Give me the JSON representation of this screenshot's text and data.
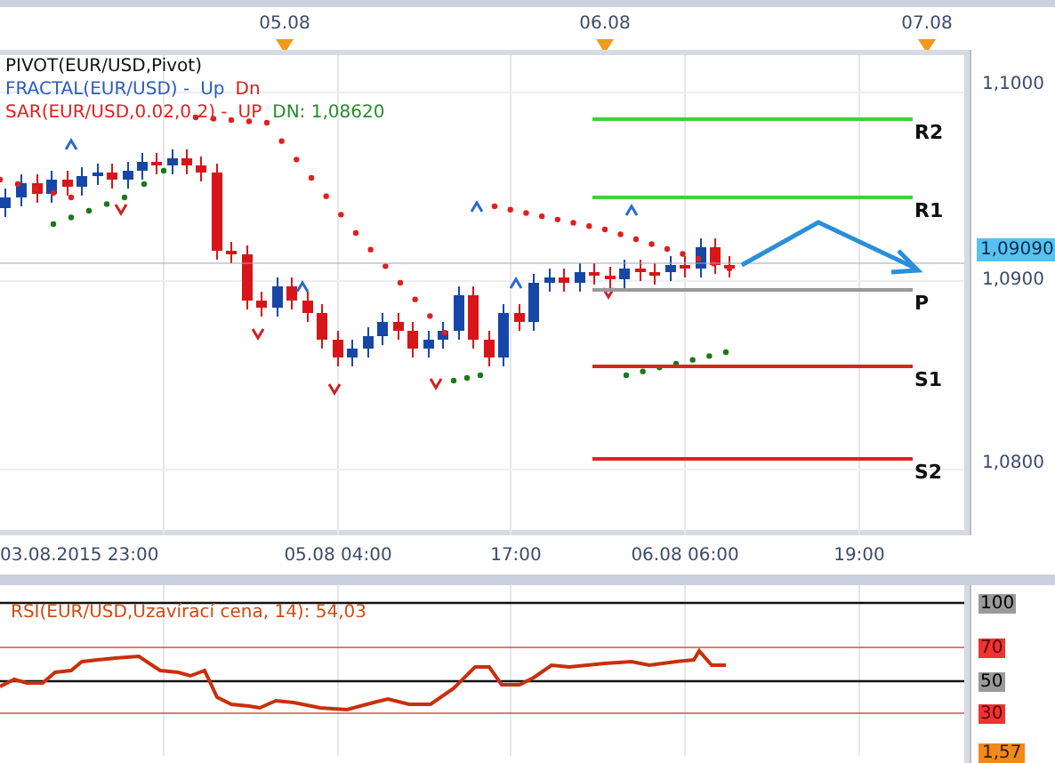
{
  "top_axis": [
    {
      "label": "05.08"
    },
    {
      "label": "06.08"
    },
    {
      "label": "07.08"
    }
  ],
  "legend": [
    {
      "kind": "plain",
      "name": "PIVOT(EUR/USD,Pivot)"
    },
    {
      "kind": "fractal",
      "name": "FRACTAL(EUR/USD) -",
      "up": "Up",
      "down": "Dn"
    },
    {
      "kind": "sar",
      "name": "SAR(EUR/USD,0.02,0.2) -",
      "up": "UP",
      "down": "DN: 1,08620"
    }
  ],
  "pivot_levels": [
    {
      "label": "R2",
      "color": "#44cc44"
    },
    {
      "label": "R1",
      "color": "#44cc44"
    },
    {
      "label": "P",
      "color": "#999999"
    },
    {
      "label": "S1",
      "color": "#dd2222"
    },
    {
      "label": "S2",
      "color": "#dd2222"
    }
  ],
  "price_axis": [
    "1,1000",
    "1,0900",
    "1,0800"
  ],
  "current_price": "1,09090",
  "bottom_axis": [
    "03.08.2015 23:00",
    "05.08 04:00",
    "17:00",
    "06.08 06:00",
    "19:00"
  ],
  "rsi": {
    "title": "RSI(EUR/USD,Uzavírací cena, 14): 54,03",
    "last_value": "1,57",
    "levels": [
      {
        "label": "100",
        "kind": "bound"
      },
      {
        "label": "70",
        "kind": "band"
      },
      {
        "label": "50",
        "kind": "bound"
      },
      {
        "label": "30",
        "kind": "band"
      }
    ]
  }
}
